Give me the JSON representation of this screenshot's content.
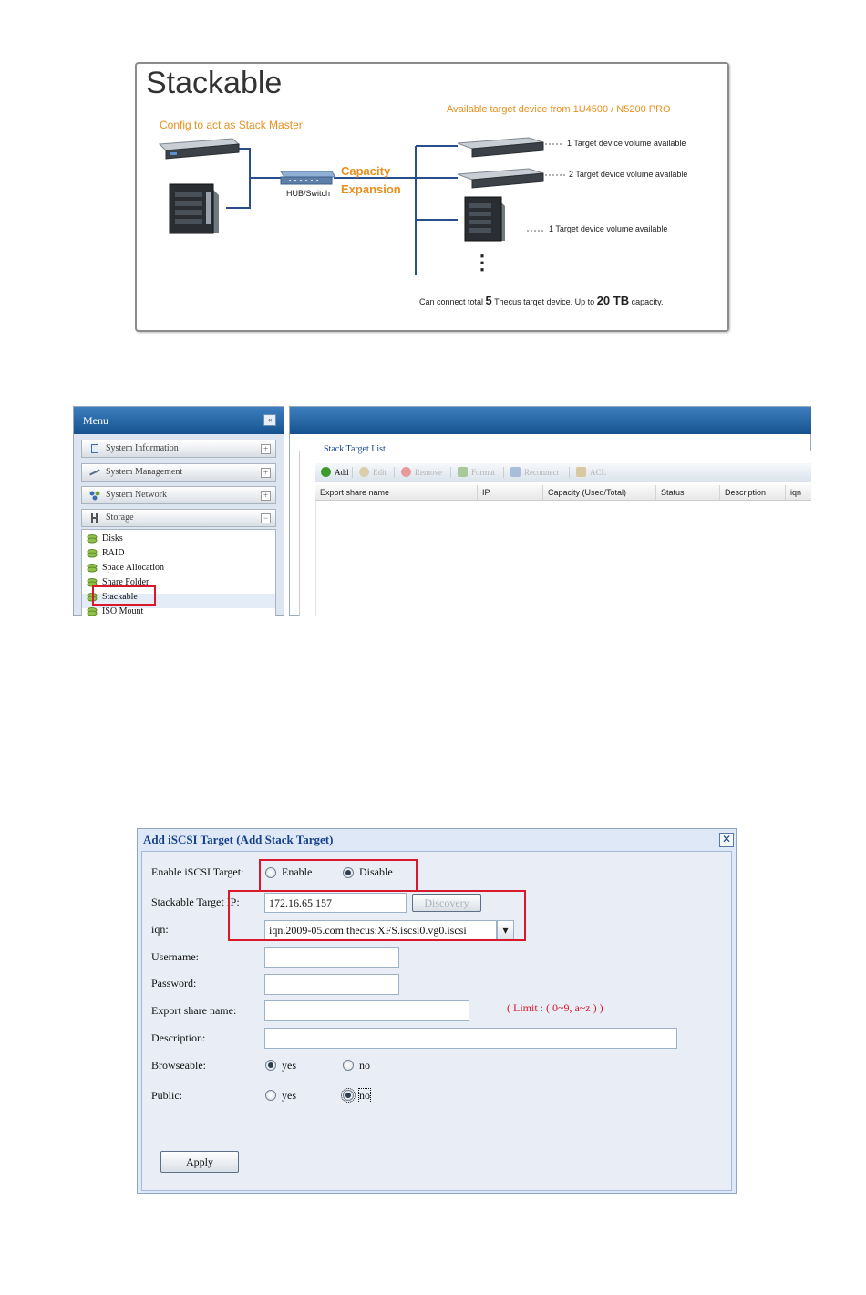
{
  "diagram": {
    "title": "Stackable",
    "master_label": "Config to act as Stack Master",
    "available_label": "Available target device from 1U4500 / N5200 PRO",
    "capacity_label": "Capacity",
    "expansion_label": "Expansion",
    "hub_label": "HUB/Switch",
    "target_1": "1 Target device volume available",
    "target_2": "2 Target device volume available",
    "target_3": "1 Target device volume available",
    "dots": "⋮",
    "bottom_a": "Can connect total ",
    "bottom_num1": "5",
    "bottom_b": " Thecus target device.   Up to ",
    "bottom_num2": "20 TB",
    "bottom_c": " capacity."
  },
  "menu": {
    "title": "Menu",
    "collapse": "«",
    "categories": [
      {
        "label": "System Information",
        "toggle": "+"
      },
      {
        "label": "System Management",
        "toggle": "+"
      },
      {
        "label": "System Network",
        "toggle": "+"
      },
      {
        "label": "Storage",
        "toggle": "−"
      }
    ],
    "storage_items": [
      "Disks",
      "RAID",
      "Space Allocation",
      "Share Folder",
      "Stackable",
      "ISO Mount"
    ]
  },
  "stack_list": {
    "title": "Stack Target List",
    "toolbar": [
      "Add",
      "Edit",
      "Remove",
      "Format",
      "Reconnect",
      "ACL"
    ],
    "columns": [
      "Export share name",
      "IP",
      "Capacity (Used/Total)",
      "Status",
      "Description",
      "iqn"
    ]
  },
  "dialog": {
    "title": "Add iSCSI Target (Add Stack Target)",
    "close": "✕",
    "enable_label": "Enable iSCSI Target:",
    "enable_opt": "Enable",
    "disable_opt": "Disable",
    "target_ip_label": "Stackable Target IP:",
    "target_ip_value": "172.16.65.157",
    "discovery_btn": "Discovery",
    "iqn_label": "iqn:",
    "iqn_value": "iqn.2009-05.com.thecus:XFS.iscsi0.vg0.iscsi",
    "iqn_arrow": "▾",
    "username_label": "Username:",
    "password_label": "Password:",
    "export_label": "Export share name:",
    "limit_text": "( Limit : ( 0~9, a~z ) )",
    "description_label": "Description:",
    "browseable_label": "Browseable:",
    "public_label": "Public:",
    "yes": "yes",
    "no": "no",
    "apply_btn": "Apply"
  },
  "colors": {
    "accent_orange": "#e8901f",
    "header_blue": "#15528f",
    "highlight_red": "#d9182b",
    "title_blue": "#15428b"
  }
}
